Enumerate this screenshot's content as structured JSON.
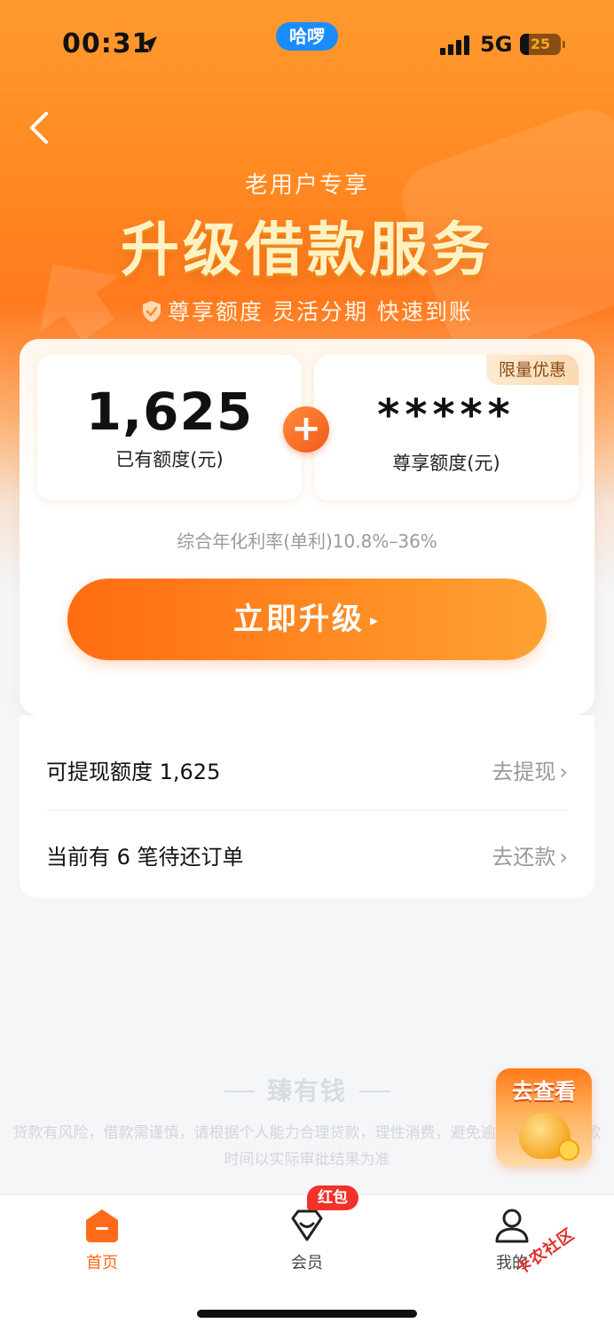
{
  "status_bar": {
    "time": "00:31",
    "pill_label": "哈啰",
    "network": "5G",
    "battery": "25"
  },
  "header": {
    "subtitle": "老用户专享",
    "title": "升级借款服务",
    "features": "尊享额度 灵活分期 快速到账"
  },
  "quota_card": {
    "existing_amount": "1,625",
    "existing_caption": "已有额度(元)",
    "exclusive_amount": "*****",
    "exclusive_caption": "尊享额度(元)",
    "limited_tag": "限量优惠",
    "plus_symbol": "+",
    "rate_text": "综合年化利率(单利)10.8%–36%",
    "upgrade_button": "立即升级",
    "upgrade_arrow": "▸"
  },
  "info_list": {
    "rows": [
      {
        "label": "可提现额度 1,625",
        "action": "去提现",
        "chevron": "›"
      },
      {
        "label": "当前有 6 笔待还订单",
        "action": "去还款",
        "chevron": "›"
      }
    ]
  },
  "footer": {
    "brand": "臻有钱",
    "disclaimer": "贷款有风险，借款需谨慎，请根据个人能力合理贷款，理性消费，避免逾期。额度、放款时间以实际审批结果为准"
  },
  "promo": {
    "label": "去查看"
  },
  "tab_bar": {
    "tabs": [
      {
        "label": "首页",
        "icon": "home-icon",
        "active": true
      },
      {
        "label": "会员",
        "icon": "member-icon",
        "active": false
      },
      {
        "label": "我的",
        "icon": "profile-icon",
        "active": false
      }
    ],
    "member_badge": "红包"
  },
  "watermark": "卡农社区",
  "colors": {
    "accent": "#ff7a1e",
    "button_start": "#ff6c12",
    "button_end": "#ffa233",
    "badge": "#f0322a",
    "pill": "#1a8cff"
  }
}
